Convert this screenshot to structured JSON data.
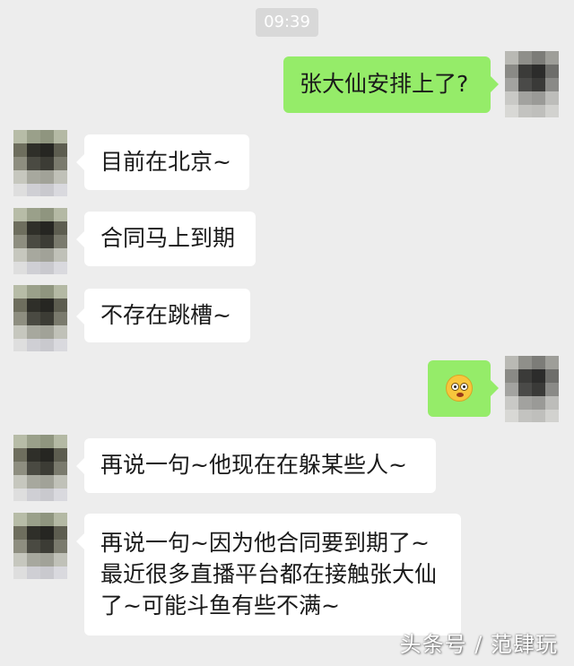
{
  "chat": {
    "timestamp": "09:39",
    "messages": [
      {
        "side": "right",
        "lines": [
          "张大仙安排上了?"
        ]
      },
      {
        "side": "left",
        "lines": [
          "目前在北京~"
        ]
      },
      {
        "side": "left",
        "lines": [
          "合同马上到期"
        ]
      },
      {
        "side": "left",
        "lines": [
          "不存在跳槽~"
        ]
      },
      {
        "side": "right",
        "emoji": "shocked-face-emoji"
      },
      {
        "side": "left",
        "lines": [
          "再说一句~他现在在躲某些人~"
        ]
      },
      {
        "side": "left",
        "lines": [
          "再说一句~因为他合同要到期了~",
          "最近很多直播平台都在接触张大仙",
          "了~可能斗鱼有些不满~"
        ]
      }
    ]
  },
  "watermark": "头条号 / 范肆玩",
  "colors": {
    "background": "#ededed",
    "sent_bubble": "#95ec69",
    "received_bubble": "#ffffff"
  }
}
